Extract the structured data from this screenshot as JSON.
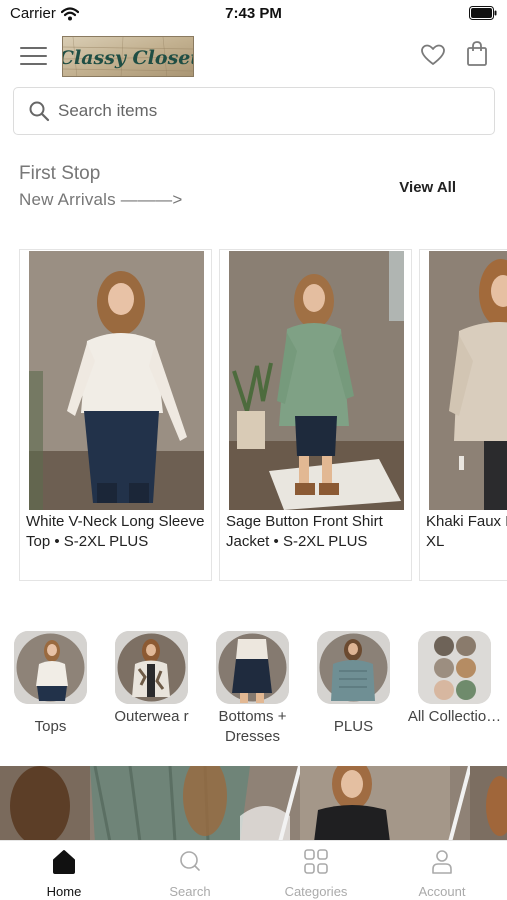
{
  "status_bar": {
    "carrier": "Carrier",
    "time": "7:43 PM"
  },
  "header": {
    "logo_text": "Classy Closet"
  },
  "search": {
    "placeholder": "Search items"
  },
  "section": {
    "title": "First Stop",
    "subtitle": "New Arrivals ———>",
    "view_all": "View All"
  },
  "products": [
    {
      "name": "White V-Neck Long Sleeve Top • S-2XL PLUS"
    },
    {
      "name": "Sage Button Front Shirt Jacket • S-2XL PLUS"
    },
    {
      "name": "Khaki Faux Fur Jacket • S-XL"
    }
  ],
  "categories": [
    {
      "label": "Tops"
    },
    {
      "label": "Outerwea r"
    },
    {
      "label": "Bottoms + Dresses"
    },
    {
      "label": "PLUS"
    },
    {
      "label": "All Collectio…"
    }
  ],
  "tabs": [
    {
      "label": "Home",
      "icon": "home-icon"
    },
    {
      "label": "Search",
      "icon": "search-icon"
    },
    {
      "label": "Categories",
      "icon": "categories-icon"
    },
    {
      "label": "Account",
      "icon": "account-icon"
    }
  ],
  "colors": {
    "accent": "#111111",
    "inactive": "#aaaaaa",
    "logo_text": "#1f4e44"
  }
}
